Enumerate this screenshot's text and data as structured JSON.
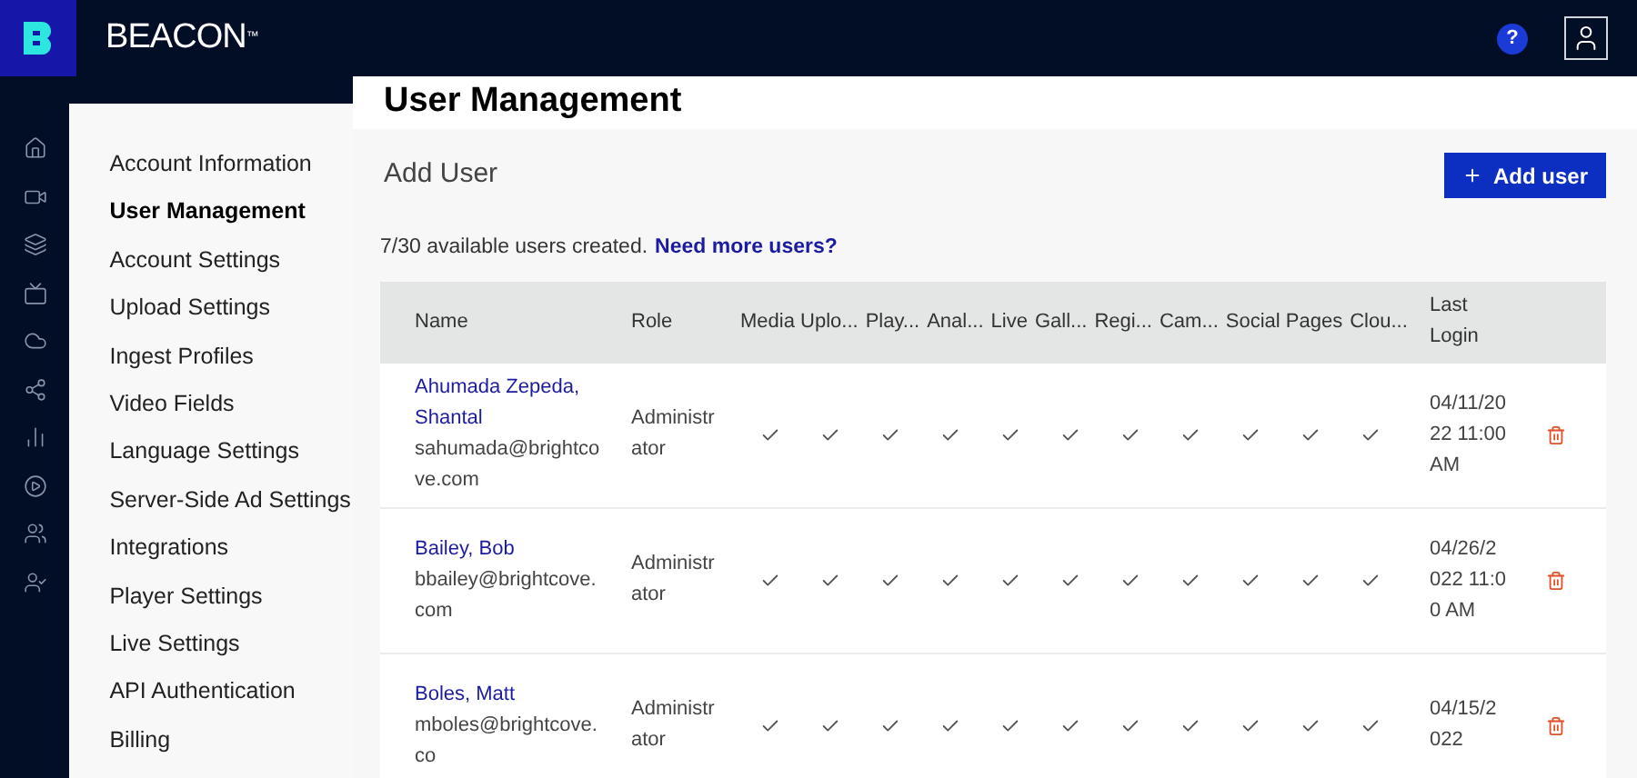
{
  "brand": {
    "name": "BEACON",
    "trademark": "™"
  },
  "topbar": {
    "help": "?"
  },
  "rail": [
    {
      "kind": "home",
      "selected": false
    },
    {
      "kind": "video",
      "selected": false
    },
    {
      "kind": "layers",
      "selected": false
    },
    {
      "kind": "tv",
      "selected": false
    },
    {
      "kind": "cloud",
      "selected": false
    },
    {
      "kind": "share",
      "selected": false
    },
    {
      "kind": "chart",
      "selected": false
    },
    {
      "kind": "play",
      "selected": false
    },
    {
      "kind": "users",
      "selected": false
    },
    {
      "kind": "user-check",
      "selected": false
    }
  ],
  "settings_nav": [
    {
      "label": "Account Information",
      "selected": false
    },
    {
      "label": "User Management",
      "selected": true
    },
    {
      "label": "Account Settings",
      "selected": false
    },
    {
      "label": "Upload Settings",
      "selected": false
    },
    {
      "label": "Ingest Profiles",
      "selected": false
    },
    {
      "label": "Video Fields",
      "selected": false
    },
    {
      "label": "Language Settings",
      "selected": false
    },
    {
      "label": "Server-Side Ad Settings",
      "selected": false
    },
    {
      "label": "Integrations",
      "selected": false
    },
    {
      "label": "Player Settings",
      "selected": false
    },
    {
      "label": "Live Settings",
      "selected": false
    },
    {
      "label": "API Authentication",
      "selected": false
    },
    {
      "label": "Billing",
      "selected": false
    }
  ],
  "page": {
    "title": "User Management",
    "section_title": "Add User",
    "add_button": "Add user",
    "quota": "7/30 available users created.",
    "quota_link": "Need more users?"
  },
  "table": {
    "columns": [
      "Name",
      "Role",
      "Media Uplo...",
      "Play...",
      "Anal...",
      "Live",
      "Gall...",
      "Regi...",
      "Cam...",
      "Social Pages",
      "Clou...",
      "Last Login"
    ],
    "rows": [
      {
        "name": "Ahumada Zepeda, Shantal",
        "email": "sahumada@brightcove.com",
        "role": "Administrator",
        "permissions": [
          true,
          true,
          true,
          true,
          true,
          true,
          true,
          true,
          true,
          true,
          true
        ],
        "last_login": "04/11/2022 11:00 AM"
      },
      {
        "name": "Bailey, Bob",
        "email": "bbailey@brightcove.com",
        "role": "Administrator",
        "permissions": [
          true,
          true,
          true,
          true,
          true,
          true,
          true,
          true,
          true,
          true,
          true
        ],
        "last_login": "04/26/2022 11:00 AM"
      },
      {
        "name": "Boles, Matt",
        "email": "mboles@brightcove.co",
        "role": "Administrator",
        "permissions": [
          true,
          true,
          true,
          true,
          true,
          true,
          true,
          true,
          true,
          true,
          true
        ],
        "last_login": "04/15/2022"
      }
    ]
  }
}
